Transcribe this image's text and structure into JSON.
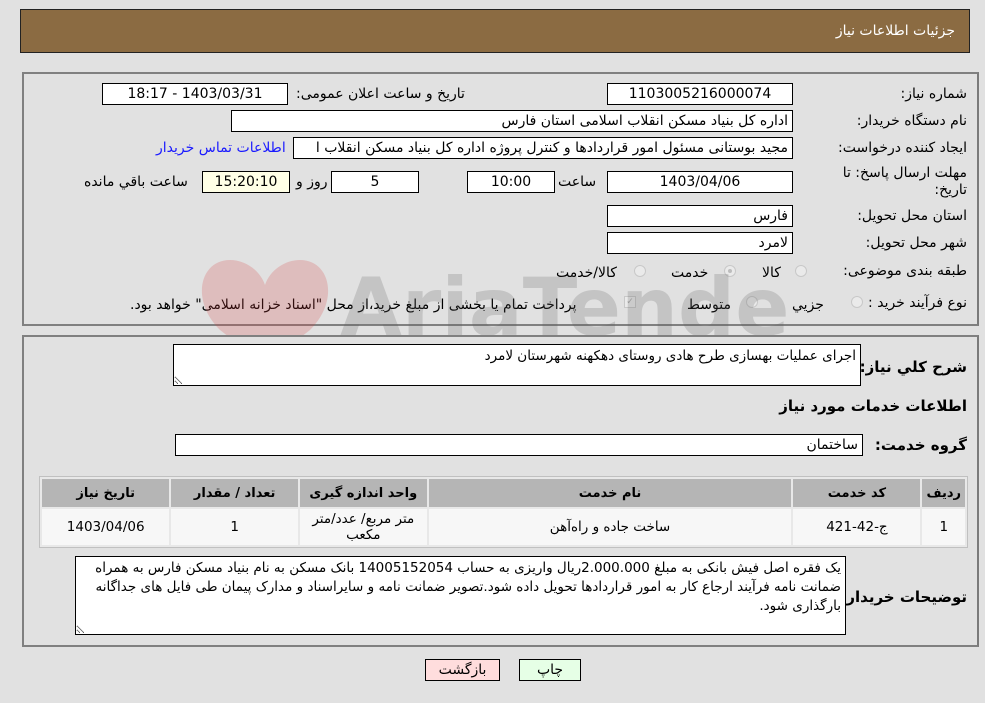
{
  "header": {
    "title": "جزئیات اطلاعات نیاز"
  },
  "form": {
    "need_number_label": "شماره نیاز:",
    "need_number": "1103005216000074",
    "announce_label": "تاریخ و ساعت اعلان عمومی:",
    "announce_value": "1403/03/31 - 18:17",
    "buyer_org_label": "نام دستگاه خریدار:",
    "buyer_org": "اداره کل بنیاد مسکن انقلاب اسلامی استان فارس",
    "creator_label": "ایجاد کننده درخواست:",
    "creator": "مجید بوستانی مسئول امور قراردادها و کنترل پروژه اداره کل بنیاد مسکن انقلاب ا",
    "contact_link": "اطلاعات تماس خریدار",
    "deadline_label_1": "مهلت ارسال پاسخ: تا",
    "deadline_label_2": "تاریخ:",
    "deadline_date": "1403/04/06",
    "time_label": "ساعت",
    "deadline_time": "10:00",
    "days_value": "5",
    "days_label": "روز و",
    "remaining_time": "15:20:10",
    "remaining_label": "ساعت باقي مانده",
    "province_label": "استان محل تحویل:",
    "province": "فارس",
    "city_label": "شهر محل تحویل:",
    "city": "لامرد",
    "category_label": "طبقه بندی موضوعی:",
    "category_options": [
      "کالا",
      "خدمت",
      "کالا/خدمت"
    ],
    "category_selected": "خدمت",
    "process_label": "نوع فرآیند خرید :",
    "process_options": [
      "جزيي",
      "متوسط"
    ],
    "treasury_note": "پرداخت تمام یا بخشی از مبلغ خرید،از محل \"اسناد خزانه اسلامی\" خواهد بود."
  },
  "details": {
    "description_label": "شرح کلي نياز:",
    "description": "اجرای عملیات بهسازی طرح هادی روستای دهکهنه شهرستان لامرد",
    "services_heading": "اطلاعات خدمات مورد نیاز",
    "service_group_label": "گروه خدمت:",
    "service_group": "ساختمان",
    "table": {
      "headers": [
        "ردیف",
        "کد خدمت",
        "نام خدمت",
        "واحد اندازه گیری",
        "تعداد / مقدار",
        "تاریخ نیاز"
      ],
      "rows": [
        [
          "1",
          "ج-42-421",
          "ساخت جاده و راه‌آهن",
          "متر مربع/ عدد/متر مکعب",
          "1",
          "1403/04/06"
        ]
      ]
    },
    "buyer_notes_label": "توضیحات خریدار:",
    "buyer_notes": "یک فقره اصل فیش بانکی به مبلغ 2.000.000ریال واریزی به حساب 14005152054 بانک مسکن به نام بنیاد مسکن فارس به همراه ضمانت نامه فرآیند ارجاع کار به امور قراردادها تحویل داده شود.تصویر ضمانت نامه و سایراسناد و مدارک پیمان طی فایل های جداگانه بارگذاری شود."
  },
  "buttons": {
    "print": "چاپ",
    "back": "بازگشت"
  },
  "watermark": {
    "text": "AriaTender.neT"
  },
  "colors": {
    "header": "#8b6b42",
    "link": "#1a1aff",
    "print_bg": "#e6ffe6",
    "back_bg": "#ffdddd"
  }
}
